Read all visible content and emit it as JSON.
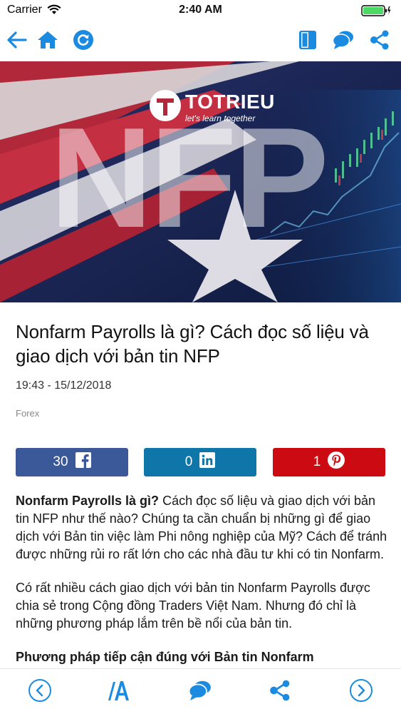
{
  "status": {
    "carrier": "Carrier",
    "time": "2:40 AM"
  },
  "colors": {
    "accent": "#1a8be0",
    "facebook": "#3b5998",
    "linkedin": "#0e76a8",
    "pinterest": "#cc0a12"
  },
  "hero": {
    "brand": "TOTRIEU",
    "tagline": "let's learn together",
    "big_text": "NFP"
  },
  "article": {
    "title": "Nonfarm Payrolls là gì? Cách đọc số liệu và giao dịch với bản tin NFP",
    "date": "19:43 - 15/12/2018",
    "category": "Forex",
    "p1_bold": "Nonfarm Payrolls là gì?",
    "p1_rest": " Cách đọc số liệu và giao dịch với bản tin NFP như thế nào? Chúng ta cần chuẩn bị những gì để giao dịch với Bản tin việc làm Phi nông nghiệp của Mỹ? Cách để tránh được những rủi ro rất lớn cho các nhà đầu tư khi có tin Nonfarm.",
    "p2": "Có rất nhiều cách giao dịch với bản tin Nonfarm Payrolls được chia sẻ trong Cộng đồng Traders Việt Nam. Nhưng đó chỉ là những phương pháp lắm trên bề nổi của bản tin.",
    "section_heading": "Phương pháp tiếp cận đúng với Bản tin Nonfarm"
  },
  "share": {
    "facebook_count": "30",
    "linkedin_count": "0",
    "pinterest_count": "1"
  }
}
